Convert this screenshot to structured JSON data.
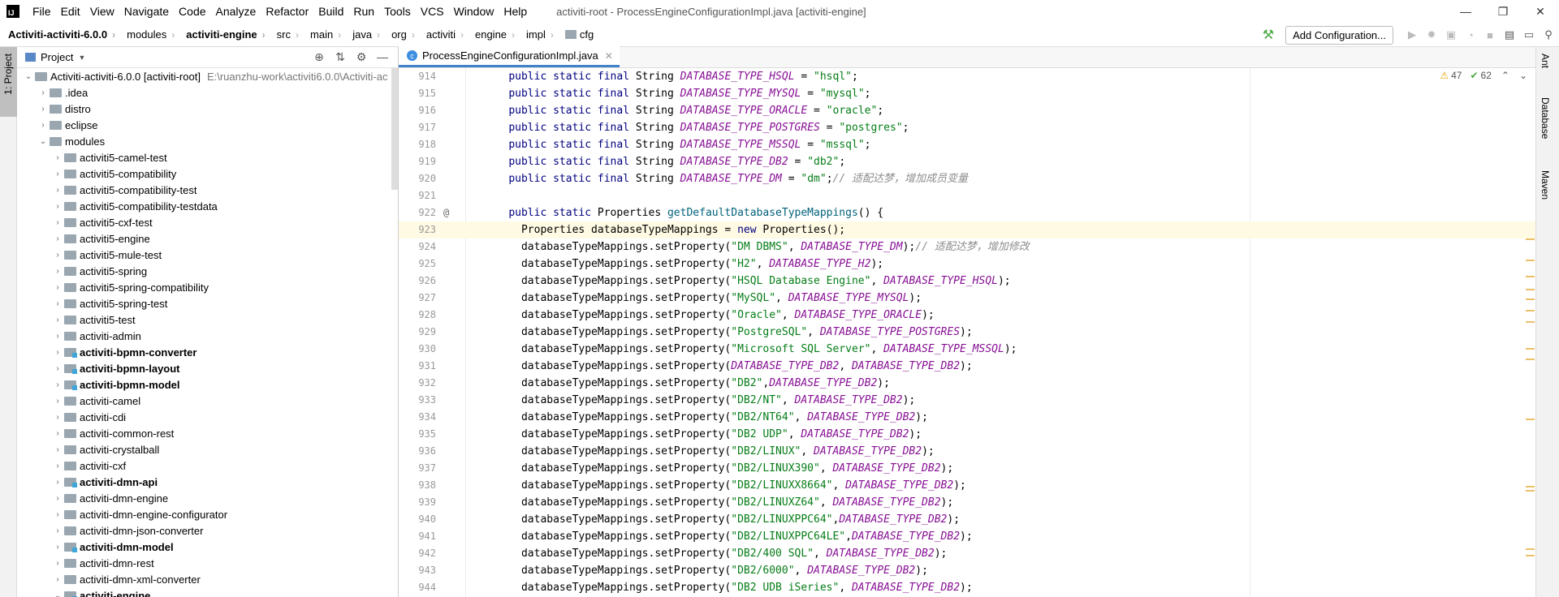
{
  "app": {
    "logo_text": "IJ",
    "window_title": "activiti-root - ProcessEngineConfigurationImpl.java [activiti-engine]"
  },
  "menu": [
    "File",
    "Edit",
    "View",
    "Navigate",
    "Code",
    "Analyze",
    "Refactor",
    "Build",
    "Run",
    "Tools",
    "VCS",
    "Window",
    "Help"
  ],
  "window_controls": [
    "—",
    "❐",
    "✕"
  ],
  "breadcrumb": [
    "Activiti-activiti-6.0.0",
    "modules",
    "activiti-engine",
    "src",
    "main",
    "java",
    "org",
    "activiti",
    "engine",
    "impl",
    "cfg"
  ],
  "toolbar": {
    "add_configuration": "Add Configuration..."
  },
  "left_stripe": {
    "tab": "1: Project"
  },
  "right_stripe": {
    "tabs": [
      "Ant",
      "Database",
      "Maven"
    ]
  },
  "project_panel": {
    "title": "Project",
    "root_label": "Activiti-activiti-6.0.0 [activiti-root]",
    "root_path": "E:\\ruanzhu-work\\activiti6.0.0\\Activiti-ac",
    "items": [
      {
        "label": "Activiti-activiti-6.0.0 [activiti-root]",
        "path": "E:\\ruanzhu-work\\activiti6.0.0\\Activiti-ac",
        "depth": 0,
        "expanded": true,
        "bold": false,
        "module": false
      },
      {
        "label": ".idea",
        "depth": 1,
        "expanded": false,
        "bold": false,
        "module": false
      },
      {
        "label": "distro",
        "depth": 1,
        "expanded": false,
        "bold": false,
        "module": false
      },
      {
        "label": "eclipse",
        "depth": 1,
        "expanded": false,
        "bold": false,
        "module": false
      },
      {
        "label": "modules",
        "depth": 1,
        "expanded": true,
        "bold": false,
        "module": false
      },
      {
        "label": "activiti5-camel-test",
        "depth": 2,
        "expanded": false,
        "bold": false,
        "module": false
      },
      {
        "label": "activiti5-compatibility",
        "depth": 2,
        "expanded": false,
        "bold": false,
        "module": false
      },
      {
        "label": "activiti5-compatibility-test",
        "depth": 2,
        "expanded": false,
        "bold": false,
        "module": false
      },
      {
        "label": "activiti5-compatibility-testdata",
        "depth": 2,
        "expanded": false,
        "bold": false,
        "module": false
      },
      {
        "label": "activiti5-cxf-test",
        "depth": 2,
        "expanded": false,
        "bold": false,
        "module": false
      },
      {
        "label": "activiti5-engine",
        "depth": 2,
        "expanded": false,
        "bold": false,
        "module": false
      },
      {
        "label": "activiti5-mule-test",
        "depth": 2,
        "expanded": false,
        "bold": false,
        "module": false
      },
      {
        "label": "activiti5-spring",
        "depth": 2,
        "expanded": false,
        "bold": false,
        "module": false
      },
      {
        "label": "activiti5-spring-compatibility",
        "depth": 2,
        "expanded": false,
        "bold": false,
        "module": false
      },
      {
        "label": "activiti5-spring-test",
        "depth": 2,
        "expanded": false,
        "bold": false,
        "module": false
      },
      {
        "label": "activiti5-test",
        "depth": 2,
        "expanded": false,
        "bold": false,
        "module": false
      },
      {
        "label": "activiti-admin",
        "depth": 2,
        "expanded": false,
        "bold": false,
        "module": false
      },
      {
        "label": "activiti-bpmn-converter",
        "depth": 2,
        "expanded": false,
        "bold": true,
        "module": true
      },
      {
        "label": "activiti-bpmn-layout",
        "depth": 2,
        "expanded": false,
        "bold": true,
        "module": true
      },
      {
        "label": "activiti-bpmn-model",
        "depth": 2,
        "expanded": false,
        "bold": true,
        "module": true
      },
      {
        "label": "activiti-camel",
        "depth": 2,
        "expanded": false,
        "bold": false,
        "module": false
      },
      {
        "label": "activiti-cdi",
        "depth": 2,
        "expanded": false,
        "bold": false,
        "module": false
      },
      {
        "label": "activiti-common-rest",
        "depth": 2,
        "expanded": false,
        "bold": false,
        "module": false
      },
      {
        "label": "activiti-crystalball",
        "depth": 2,
        "expanded": false,
        "bold": false,
        "module": false
      },
      {
        "label": "activiti-cxf",
        "depth": 2,
        "expanded": false,
        "bold": false,
        "module": false
      },
      {
        "label": "activiti-dmn-api",
        "depth": 2,
        "expanded": false,
        "bold": true,
        "module": true
      },
      {
        "label": "activiti-dmn-engine",
        "depth": 2,
        "expanded": false,
        "bold": false,
        "module": false
      },
      {
        "label": "activiti-dmn-engine-configurator",
        "depth": 2,
        "expanded": false,
        "bold": false,
        "module": false
      },
      {
        "label": "activiti-dmn-json-converter",
        "depth": 2,
        "expanded": false,
        "bold": false,
        "module": false
      },
      {
        "label": "activiti-dmn-model",
        "depth": 2,
        "expanded": false,
        "bold": true,
        "module": true
      },
      {
        "label": "activiti-dmn-rest",
        "depth": 2,
        "expanded": false,
        "bold": false,
        "module": false
      },
      {
        "label": "activiti-dmn-xml-converter",
        "depth": 2,
        "expanded": false,
        "bold": false,
        "module": false
      },
      {
        "label": "activiti-engine",
        "depth": 2,
        "expanded": true,
        "bold": true,
        "module": true
      }
    ]
  },
  "editor": {
    "tab": "ProcessEngineConfigurationImpl.java",
    "warnings": "47",
    "typos": "62",
    "current_line": 923,
    "lines": [
      {
        "n": "914",
        "t": [
          [
            "    "
          ],
          [
            "public static final ",
            "kw"
          ],
          [
            "String "
          ],
          [
            "DATABASE_TYPE_HSQL",
            "cst"
          ],
          [
            " = "
          ],
          [
            "\"hsql\"",
            "str"
          ],
          [
            ";"
          ]
        ]
      },
      {
        "n": "915",
        "t": [
          [
            "    "
          ],
          [
            "public static final ",
            "kw"
          ],
          [
            "String "
          ],
          [
            "DATABASE_TYPE_MYSQL",
            "cst"
          ],
          [
            " = "
          ],
          [
            "\"mysql\"",
            "str"
          ],
          [
            ";"
          ]
        ]
      },
      {
        "n": "916",
        "t": [
          [
            "    "
          ],
          [
            "public static final ",
            "kw"
          ],
          [
            "String "
          ],
          [
            "DATABASE_TYPE_ORACLE",
            "cst"
          ],
          [
            " = "
          ],
          [
            "\"oracle\"",
            "str"
          ],
          [
            ";"
          ]
        ]
      },
      {
        "n": "917",
        "t": [
          [
            "    "
          ],
          [
            "public static final ",
            "kw"
          ],
          [
            "String "
          ],
          [
            "DATABASE_TYPE_POSTGRES",
            "cst"
          ],
          [
            " = "
          ],
          [
            "\"postgres\"",
            "str"
          ],
          [
            ";"
          ]
        ]
      },
      {
        "n": "918",
        "t": [
          [
            "    "
          ],
          [
            "public static final ",
            "kw"
          ],
          [
            "String "
          ],
          [
            "DATABASE_TYPE_MSSQL",
            "cst"
          ],
          [
            " = "
          ],
          [
            "\"mssql\"",
            "str"
          ],
          [
            ";"
          ]
        ]
      },
      {
        "n": "919",
        "t": [
          [
            "    "
          ],
          [
            "public static final ",
            "kw"
          ],
          [
            "String "
          ],
          [
            "DATABASE_TYPE_DB2",
            "cst"
          ],
          [
            " = "
          ],
          [
            "\"db2\"",
            "str"
          ],
          [
            ";"
          ]
        ]
      },
      {
        "n": "920",
        "t": [
          [
            "    "
          ],
          [
            "public static final ",
            "kw"
          ],
          [
            "String "
          ],
          [
            "DATABASE_TYPE_DM",
            "cst"
          ],
          [
            " = "
          ],
          [
            "\"dm\"",
            "str"
          ],
          [
            ";"
          ],
          [
            "// 适配达梦，增加成员变量",
            "cmt"
          ]
        ]
      },
      {
        "n": "921",
        "t": []
      },
      {
        "n": "922",
        "mark": "@",
        "t": [
          [
            "    "
          ],
          [
            "public static ",
            "kw"
          ],
          [
            "Properties "
          ],
          [
            "getDefaultDatabaseTypeMappings",
            "fn"
          ],
          [
            "() {"
          ]
        ]
      },
      {
        "n": "923",
        "t": [
          [
            "      Properties databaseTypeMappings = "
          ],
          [
            "new ",
            "kw"
          ],
          [
            "Properties();"
          ]
        ]
      },
      {
        "n": "924",
        "t": [
          [
            "      databaseTypeMappings.setProperty("
          ],
          [
            "\"DM DBMS\"",
            "str"
          ],
          [
            ", "
          ],
          [
            "DATABASE_TYPE_DM",
            "cst"
          ],
          [
            ");"
          ],
          [
            "// 适配达梦，增加修改",
            "cmt"
          ]
        ]
      },
      {
        "n": "925",
        "t": [
          [
            "      databaseTypeMappings.setProperty("
          ],
          [
            "\"H2\"",
            "str"
          ],
          [
            ", "
          ],
          [
            "DATABASE_TYPE_H2",
            "cst"
          ],
          [
            ");"
          ]
        ]
      },
      {
        "n": "926",
        "t": [
          [
            "      databaseTypeMappings.setProperty("
          ],
          [
            "\"HSQL Database Engine\"",
            "str"
          ],
          [
            ", "
          ],
          [
            "DATABASE_TYPE_HSQL",
            "cst"
          ],
          [
            ");"
          ]
        ]
      },
      {
        "n": "927",
        "t": [
          [
            "      databaseTypeMappings.setProperty("
          ],
          [
            "\"MySQL\"",
            "str"
          ],
          [
            ", "
          ],
          [
            "DATABASE_TYPE_MYSQL",
            "cst"
          ],
          [
            ");"
          ]
        ]
      },
      {
        "n": "928",
        "t": [
          [
            "      databaseTypeMappings.setProperty("
          ],
          [
            "\"Oracle\"",
            "str"
          ],
          [
            ", "
          ],
          [
            "DATABASE_TYPE_ORACLE",
            "cst"
          ],
          [
            ");"
          ]
        ]
      },
      {
        "n": "929",
        "t": [
          [
            "      databaseTypeMappings.setProperty("
          ],
          [
            "\"PostgreSQL\"",
            "str"
          ],
          [
            ", "
          ],
          [
            "DATABASE_TYPE_POSTGRES",
            "cst"
          ],
          [
            ");"
          ]
        ]
      },
      {
        "n": "930",
        "t": [
          [
            "      databaseTypeMappings.setProperty("
          ],
          [
            "\"Microsoft SQL Server\"",
            "str"
          ],
          [
            ", "
          ],
          [
            "DATABASE_TYPE_MSSQL",
            "cst"
          ],
          [
            ");"
          ]
        ]
      },
      {
        "n": "931",
        "t": [
          [
            "      databaseTypeMappings.setProperty("
          ],
          [
            "DATABASE_TYPE_DB2",
            "cst"
          ],
          [
            ", "
          ],
          [
            "DATABASE_TYPE_DB2",
            "cst"
          ],
          [
            ");"
          ]
        ]
      },
      {
        "n": "932",
        "t": [
          [
            "      databaseTypeMappings.setProperty("
          ],
          [
            "\"DB2\"",
            "str"
          ],
          [
            ","
          ],
          [
            "DATABASE_TYPE_DB2",
            "cst"
          ],
          [
            ");"
          ]
        ]
      },
      {
        "n": "933",
        "t": [
          [
            "      databaseTypeMappings.setProperty("
          ],
          [
            "\"DB2/NT\"",
            "str"
          ],
          [
            ", "
          ],
          [
            "DATABASE_TYPE_DB2",
            "cst"
          ],
          [
            ");"
          ]
        ]
      },
      {
        "n": "934",
        "t": [
          [
            "      databaseTypeMappings.setProperty("
          ],
          [
            "\"DB2/NT64\"",
            "str"
          ],
          [
            ", "
          ],
          [
            "DATABASE_TYPE_DB2",
            "cst"
          ],
          [
            ");"
          ]
        ]
      },
      {
        "n": "935",
        "t": [
          [
            "      databaseTypeMappings.setProperty("
          ],
          [
            "\"DB2 UDP\"",
            "str"
          ],
          [
            ", "
          ],
          [
            "DATABASE_TYPE_DB2",
            "cst"
          ],
          [
            ");"
          ]
        ]
      },
      {
        "n": "936",
        "t": [
          [
            "      databaseTypeMappings.setProperty("
          ],
          [
            "\"DB2/LINUX\"",
            "str"
          ],
          [
            ", "
          ],
          [
            "DATABASE_TYPE_DB2",
            "cst"
          ],
          [
            ");"
          ]
        ]
      },
      {
        "n": "937",
        "t": [
          [
            "      databaseTypeMappings.setProperty("
          ],
          [
            "\"DB2/LINUX390\"",
            "str"
          ],
          [
            ", "
          ],
          [
            "DATABASE_TYPE_DB2",
            "cst"
          ],
          [
            ");"
          ]
        ]
      },
      {
        "n": "938",
        "t": [
          [
            "      databaseTypeMappings.setProperty("
          ],
          [
            "\"DB2/LINUXX8664\"",
            "str"
          ],
          [
            ", "
          ],
          [
            "DATABASE_TYPE_DB2",
            "cst"
          ],
          [
            ");"
          ]
        ]
      },
      {
        "n": "939",
        "t": [
          [
            "      databaseTypeMappings.setProperty("
          ],
          [
            "\"DB2/LINUXZ64\"",
            "str"
          ],
          [
            ", "
          ],
          [
            "DATABASE_TYPE_DB2",
            "cst"
          ],
          [
            ");"
          ]
        ]
      },
      {
        "n": "940",
        "t": [
          [
            "      databaseTypeMappings.setProperty("
          ],
          [
            "\"DB2/LINUXPPC64\"",
            "str"
          ],
          [
            ","
          ],
          [
            "DATABASE_TYPE_DB2",
            "cst"
          ],
          [
            ");"
          ]
        ]
      },
      {
        "n": "941",
        "t": [
          [
            "      databaseTypeMappings.setProperty("
          ],
          [
            "\"DB2/LINUXPPC64LE\"",
            "str"
          ],
          [
            ","
          ],
          [
            "DATABASE_TYPE_DB2",
            "cst"
          ],
          [
            ");"
          ]
        ]
      },
      {
        "n": "942",
        "t": [
          [
            "      databaseTypeMappings.setProperty("
          ],
          [
            "\"DB2/400 SQL\"",
            "str"
          ],
          [
            ", "
          ],
          [
            "DATABASE_TYPE_DB2",
            "cst"
          ],
          [
            ");"
          ]
        ]
      },
      {
        "n": "943",
        "t": [
          [
            "      databaseTypeMappings.setProperty("
          ],
          [
            "\"DB2/6000\"",
            "str"
          ],
          [
            ", "
          ],
          [
            "DATABASE_TYPE_DB2",
            "cst"
          ],
          [
            ");"
          ]
        ]
      },
      {
        "n": "944",
        "t": [
          [
            "      databaseTypeMappings.setProperty("
          ],
          [
            "\"DB2 UDB iSeries\"",
            "str"
          ],
          [
            ", "
          ],
          [
            "DATABASE_TYPE_DB2",
            "cst"
          ],
          [
            ");"
          ]
        ]
      }
    ]
  }
}
